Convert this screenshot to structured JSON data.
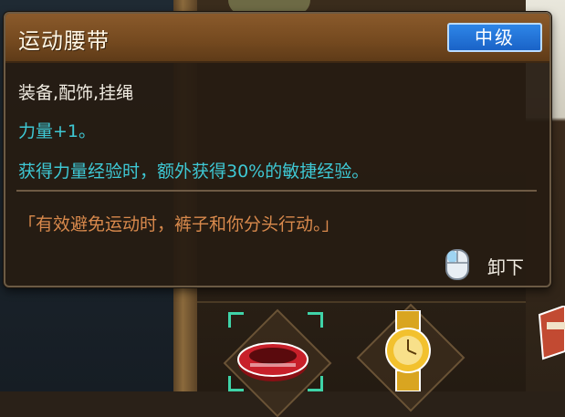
{
  "tooltip": {
    "title": "运动腰带",
    "rank": "中级",
    "category": "装备,配饰,挂绳",
    "effects": [
      "力量+1。",
      "获得力量经验时，额外获得30%的敏捷经验。"
    ],
    "flavor": "「有效避免运动时，裤子和你分头行动。」",
    "action": {
      "icon": "mouse-icon",
      "label": "卸下"
    }
  },
  "inventory": {
    "slots": [
      {
        "item": "sports-belt",
        "selected": true
      },
      {
        "item": "gold-watch",
        "selected": false
      },
      {
        "item": "partial-item",
        "selected": false
      }
    ]
  },
  "colors": {
    "header": "#74491f",
    "rank_badge": "#1a63c7",
    "effect_text": "#3ec8d4",
    "flavor_text": "#d8894c",
    "selection": "#3fd3a8"
  }
}
